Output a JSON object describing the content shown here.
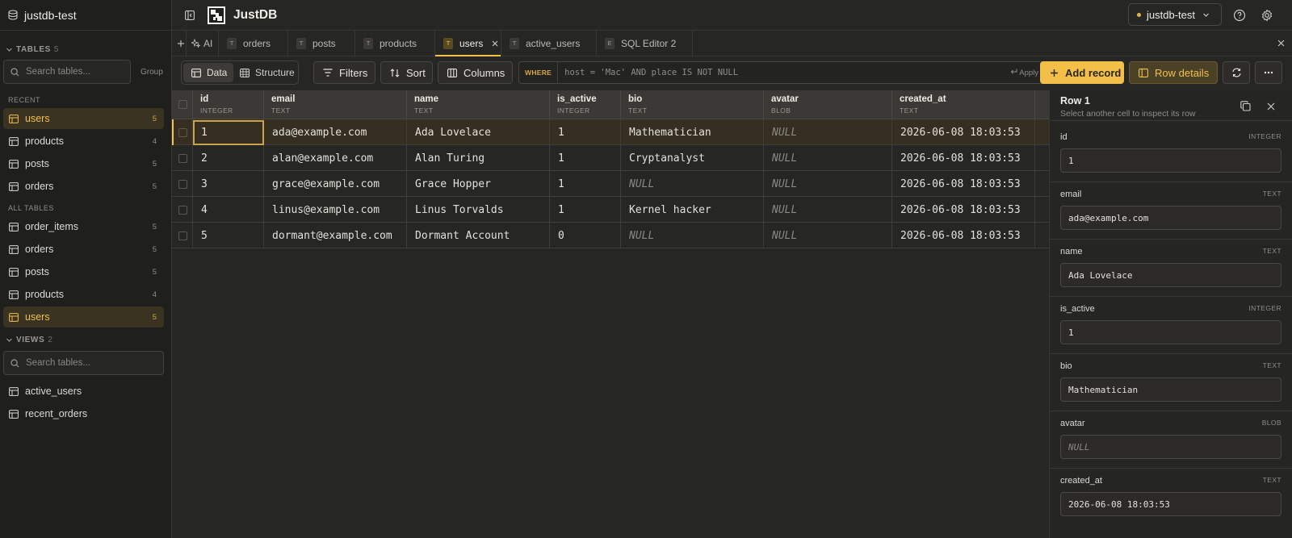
{
  "sidebar": {
    "db_name": "justdb-test",
    "tables_title": "TABLES",
    "tables_count": "5",
    "search_placeholder": "Search tables...",
    "group_label": "Group",
    "recent_title": "RECENT",
    "recent": [
      {
        "name": "users",
        "count": "5"
      },
      {
        "name": "products",
        "count": "4"
      },
      {
        "name": "posts",
        "count": "5"
      },
      {
        "name": "orders",
        "count": "5"
      }
    ],
    "all_title": "ALL TABLES",
    "all": [
      {
        "name": "order_items",
        "count": "5"
      },
      {
        "name": "orders",
        "count": "5"
      },
      {
        "name": "posts",
        "count": "5"
      },
      {
        "name": "products",
        "count": "4"
      },
      {
        "name": "users",
        "count": "5"
      }
    ],
    "views_title": "VIEWS",
    "views_count": "2",
    "views_search_placeholder": "Search tables...",
    "views": [
      {
        "name": "active_users"
      },
      {
        "name": "recent_orders"
      }
    ]
  },
  "topbar": {
    "app_name": "JustDB",
    "connection": "justdb-test"
  },
  "tabs": {
    "ai_label": "AI",
    "items": [
      {
        "badge": "T",
        "label": "orders"
      },
      {
        "badge": "T",
        "label": "posts"
      },
      {
        "badge": "T",
        "label": "products"
      },
      {
        "badge": "T",
        "label": "users"
      },
      {
        "badge": "T",
        "label": "active_users"
      },
      {
        "badge": "E",
        "label": "SQL Editor 2"
      }
    ]
  },
  "toolbar": {
    "data_label": "Data",
    "structure_label": "Structure",
    "filters_label": "Filters",
    "sort_label": "Sort",
    "columns_label": "Columns",
    "where_keyword": "WHERE",
    "where_query": "host = 'Mac' AND place IS NOT NULL",
    "apply_label": "Apply",
    "add_record_label": "Add record",
    "row_details_label": "Row details"
  },
  "grid": {
    "columns": [
      {
        "name": "id",
        "type": "INTEGER"
      },
      {
        "name": "email",
        "type": "TEXT"
      },
      {
        "name": "name",
        "type": "TEXT"
      },
      {
        "name": "is_active",
        "type": "INTEGER"
      },
      {
        "name": "bio",
        "type": "TEXT"
      },
      {
        "name": "avatar",
        "type": "BLOB"
      },
      {
        "name": "created_at",
        "type": "TEXT"
      }
    ],
    "rows": [
      [
        "1",
        "ada@example.com",
        "Ada Lovelace",
        "1",
        "Mathematician",
        "NULL",
        "2026-06-08 18:03:53"
      ],
      [
        "2",
        "alan@example.com",
        "Alan Turing",
        "1",
        "Cryptanalyst",
        "NULL",
        "2026-06-08 18:03:53"
      ],
      [
        "3",
        "grace@example.com",
        "Grace Hopper",
        "1",
        "NULL",
        "NULL",
        "2026-06-08 18:03:53"
      ],
      [
        "4",
        "linus@example.com",
        "Linus Torvalds",
        "1",
        "Kernel hacker",
        "NULL",
        "2026-06-08 18:03:53"
      ],
      [
        "5",
        "dormant@example.com",
        "Dormant Account",
        "0",
        "NULL",
        "NULL",
        "2026-06-08 18:03:53"
      ]
    ]
  },
  "details": {
    "title": "Row 1",
    "subtitle": "Select another cell to inspect its row",
    "fields": [
      {
        "name": "id",
        "type": "INTEGER",
        "value": "1"
      },
      {
        "name": "email",
        "type": "TEXT",
        "value": "ada@example.com"
      },
      {
        "name": "name",
        "type": "TEXT",
        "value": "Ada Lovelace"
      },
      {
        "name": "is_active",
        "type": "INTEGER",
        "value": "1"
      },
      {
        "name": "bio",
        "type": "TEXT",
        "value": "Mathematician"
      },
      {
        "name": "avatar",
        "type": "BLOB",
        "value": "NULL"
      },
      {
        "name": "created_at",
        "type": "TEXT",
        "value": "2026-06-08 18:03:53"
      }
    ]
  },
  "colors": {
    "accent": "#f3c04b",
    "background": "#262624",
    "sidebar": "#1f1f1e"
  }
}
